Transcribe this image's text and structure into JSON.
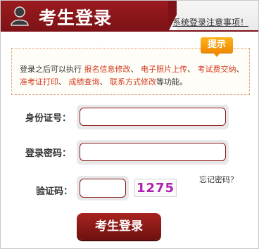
{
  "header": {
    "title": "考生登录",
    "notice_link": "系统登录注意事项！"
  },
  "tip": {
    "badge": "提示",
    "segments": [
      {
        "text": "登录之后可以执行 ",
        "highlight": false
      },
      {
        "text": "报名信息修改",
        "highlight": true
      },
      {
        "text": "、 ",
        "highlight": false
      },
      {
        "text": "电子照片上传",
        "highlight": true
      },
      {
        "text": "、 ",
        "highlight": false
      },
      {
        "text": "考试费交纳",
        "highlight": true
      },
      {
        "text": "、 ",
        "highlight": false
      },
      {
        "text": "准考证打印",
        "highlight": true
      },
      {
        "text": "、 ",
        "highlight": false
      },
      {
        "text": "成绩查询",
        "highlight": true
      },
      {
        "text": "、 ",
        "highlight": false
      },
      {
        "text": "联系方式修改",
        "highlight": true
      },
      {
        "text": "等功能。",
        "highlight": false
      }
    ]
  },
  "form": {
    "id_label": "身份证号：",
    "id_value": "",
    "password_label": "登录密码：",
    "password_value": "",
    "forgot_password": "忘记密码？",
    "captcha_label": "验证码：",
    "captcha_value": "",
    "captcha_image_text": "1275",
    "submit_label": "考生登录"
  },
  "colors": {
    "header_dark_red": "#7c1216",
    "highlight_red": "#d23a1c",
    "badge_orange": "#f08a00",
    "captcha_purple": "#b020b0"
  }
}
